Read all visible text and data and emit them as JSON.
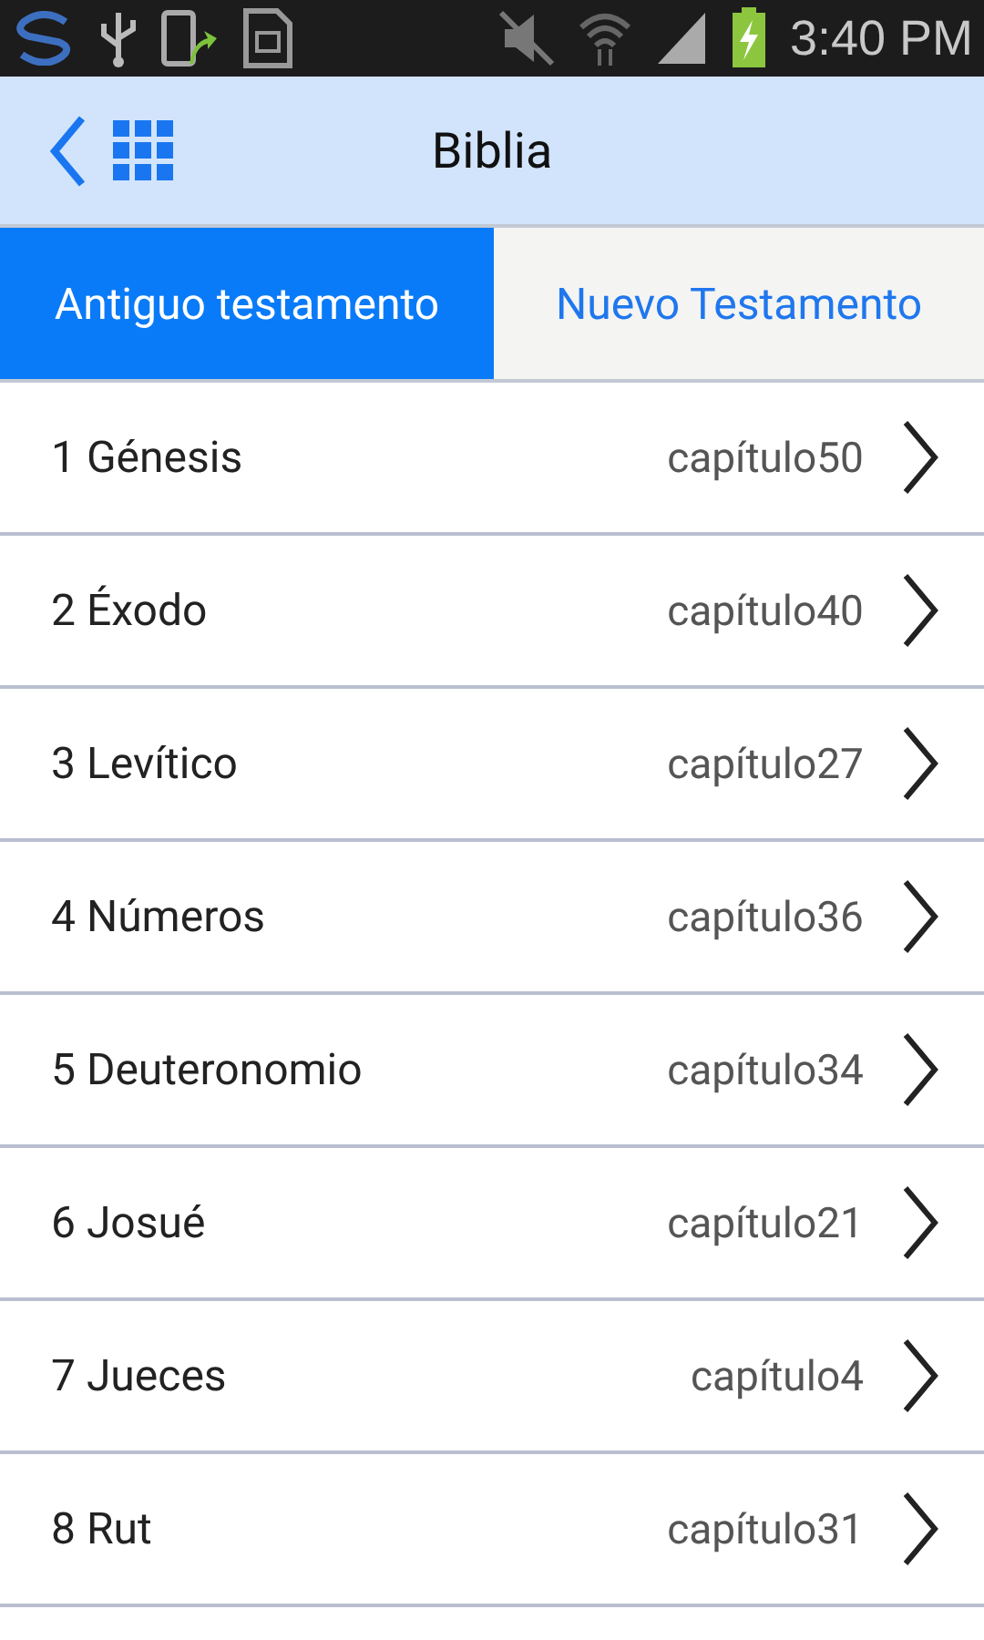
{
  "status_bar": {
    "time": "3:40 PM"
  },
  "header": {
    "title": "Biblia"
  },
  "tabs": [
    {
      "label": "Antiguo testamento",
      "selected": true
    },
    {
      "label": "Nuevo Testamento",
      "selected": false
    }
  ],
  "books": [
    {
      "name": "1 Génesis",
      "chapters": "capítulo50"
    },
    {
      "name": "2 Éxodo",
      "chapters": "capítulo40"
    },
    {
      "name": "3 Levítico",
      "chapters": "capítulo27"
    },
    {
      "name": "4 Números",
      "chapters": "capítulo36"
    },
    {
      "name": "5 Deuteronomio",
      "chapters": "capítulo34"
    },
    {
      "name": "6 Josué",
      "chapters": "capítulo21"
    },
    {
      "name": "7 Jueces",
      "chapters": "capítulo4"
    },
    {
      "name": "8 Rut",
      "chapters": "capítulo31"
    }
  ]
}
